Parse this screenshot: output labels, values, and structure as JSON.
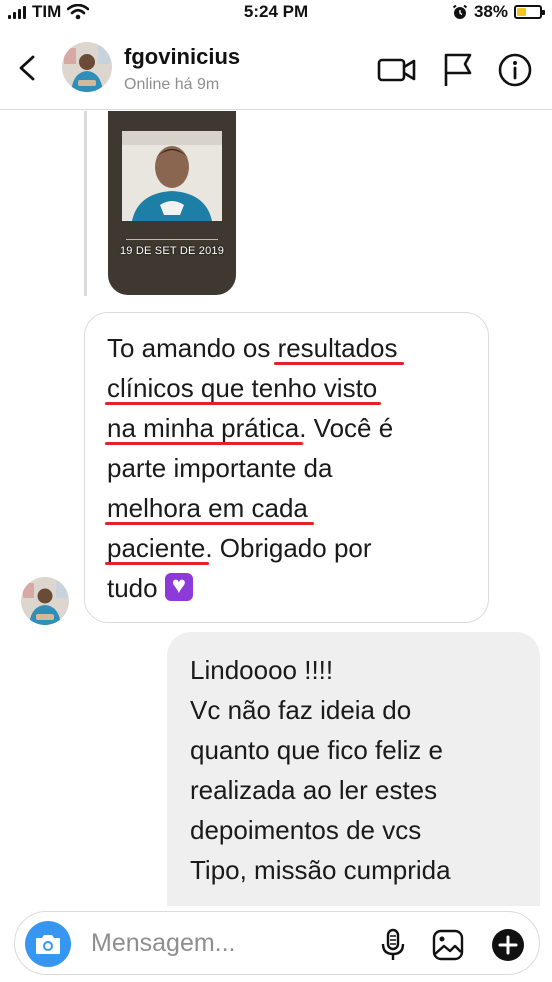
{
  "status_bar": {
    "carrier": "TIM",
    "time": "5:24 PM",
    "battery_percent": "38%",
    "battery_level": 0.38,
    "icons": [
      "signal-icon",
      "wifi-icon",
      "alarm-icon",
      "battery-icon"
    ]
  },
  "header": {
    "username": "fgovinicius",
    "status": "Online há 9m",
    "icons": [
      "back-chevron-icon",
      "video-call-icon",
      "flag-icon",
      "info-icon"
    ]
  },
  "story": {
    "date_text": "19 DE SET DE 2019"
  },
  "incoming_message": {
    "lines": [
      [
        "To amando os ",
        "resultados"
      ],
      [
        "clínicos que tenho visto"
      ],
      [
        "na minha prática",
        ". Você é"
      ],
      [
        "parte importante da"
      ],
      [
        "melhora em cada"
      ],
      [
        "paciente",
        ". Obrigado por"
      ],
      [
        "tudo "
      ]
    ],
    "emoji": "purple-heart-icon"
  },
  "outgoing_message": {
    "lines": [
      "Lindoooo !!!!",
      "Vc não faz ideia do",
      "quanto que fico feliz e",
      "realizada ao ler estes",
      "depoimentos de vcs",
      "Tipo, missão cumprida"
    ]
  },
  "composer": {
    "placeholder": "Mensagem...",
    "icons": [
      "camera-icon",
      "microphone-icon",
      "gallery-icon",
      "add-icon"
    ]
  },
  "colors": {
    "accent_blue": "#3797f0",
    "underline_red": "#e3202b",
    "bubble_gray": "#efefef",
    "secondary_text": "#8e8e8e",
    "heart_purple": "#8c3ad8"
  }
}
